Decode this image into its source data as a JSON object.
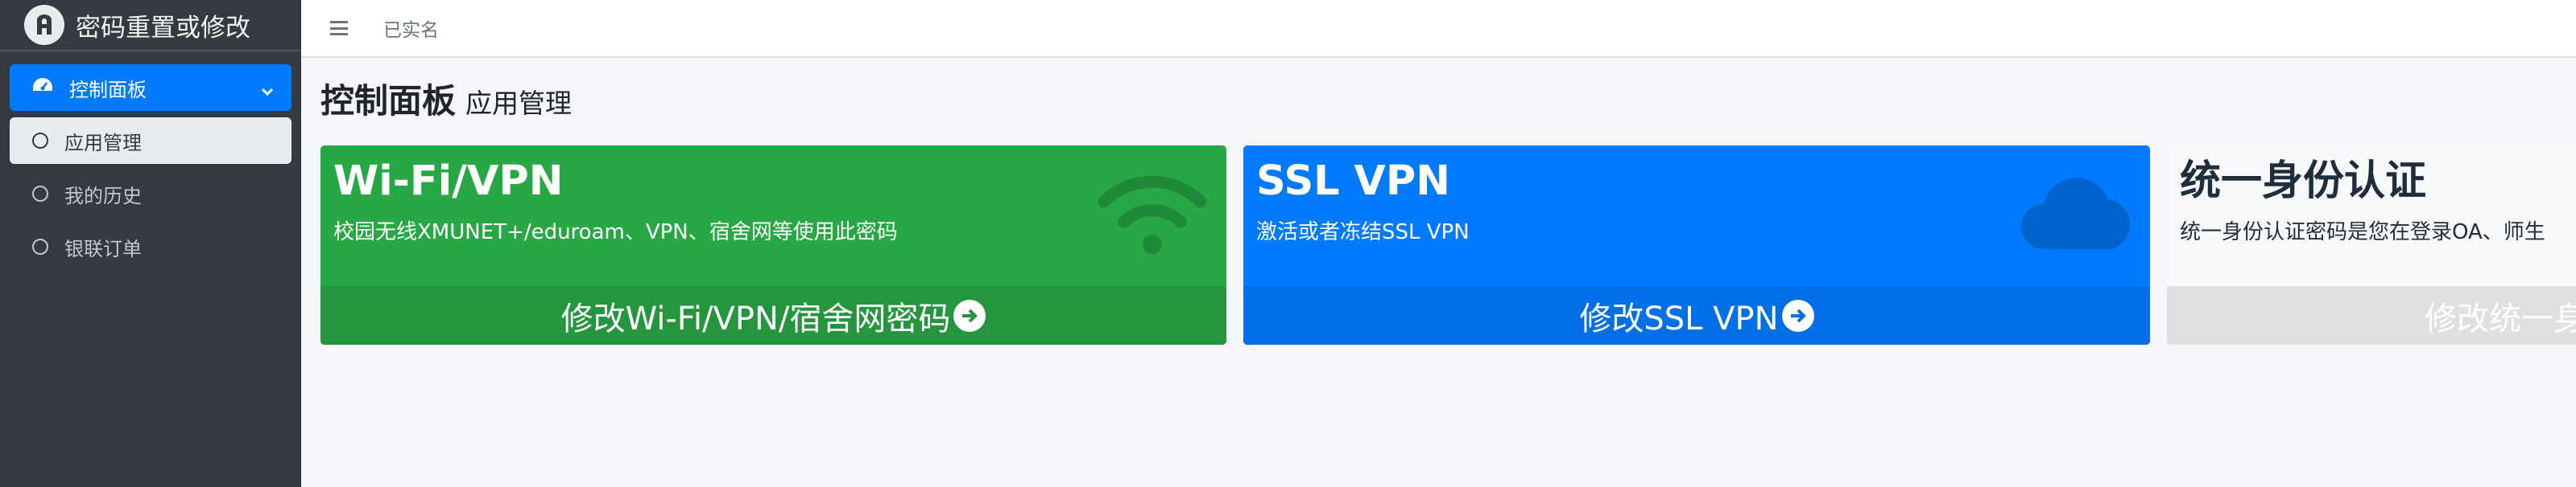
{
  "brand": {
    "title": "密码重置或修改",
    "logo_icon": "user-badge-icon"
  },
  "sidebar": {
    "items": [
      {
        "label": "控制面板",
        "icon": "dashboard-icon",
        "state": "active"
      },
      {
        "label": "应用管理",
        "icon": "circle-icon",
        "state": "selected"
      },
      {
        "label": "我的历史",
        "icon": "circle-icon",
        "state": "normal"
      },
      {
        "label": "银联订单",
        "icon": "circle-icon",
        "state": "normal"
      }
    ]
  },
  "navbar": {
    "status_text": "已实名",
    "menu_icon": "hamburger-icon"
  },
  "header": {
    "title": "控制面板",
    "subtitle": "应用管理"
  },
  "cards": [
    {
      "title": "Wi-Fi/VPN",
      "description": "校园无线XMUNET+/eduroam、VPN、宿舍网等使用此密码",
      "action": "修改Wi-Fi/VPN/宿舍网密码",
      "icon": "wifi-icon",
      "color": "#28a745"
    },
    {
      "title": "SSL VPN",
      "description": "激活或者冻结SSL VPN",
      "action": "修改SSL VPN",
      "icon": "cloud-icon",
      "color": "#007bff"
    },
    {
      "title": "统一身份认证",
      "description": "统一身份认证密码是您在登录OA、师生",
      "action": "修改统一身",
      "icon": "",
      "color": "#f8f9fa"
    }
  ]
}
